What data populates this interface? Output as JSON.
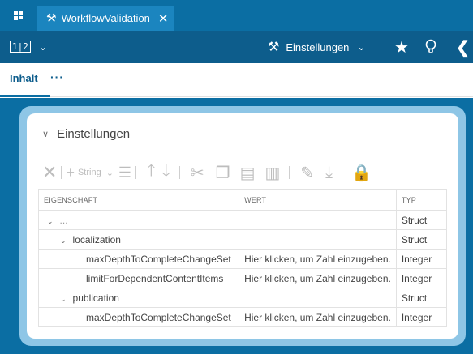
{
  "title_bar": {
    "tab_title": "WorkflowValidation",
    "tab_icon": "tools-icon",
    "close_glyph": "✕"
  },
  "toolbar": {
    "view_switch_label": "1|2",
    "settings_label": "Einstellungen",
    "icons": [
      "star-icon",
      "lightbulb-icon",
      "chevron-left-icon"
    ]
  },
  "subtabs": {
    "active": "Inhalt",
    "more": "···"
  },
  "section": {
    "title": "Einstellungen"
  },
  "edit_toolbar": {
    "string_label": "String"
  },
  "table": {
    "headers": [
      "EIGENSCHAFT",
      "WERT",
      "TYP"
    ],
    "rows": [
      {
        "name": "...",
        "value": "",
        "type": "Struct"
      },
      {
        "name": "localization",
        "value": "",
        "type": "Struct"
      },
      {
        "name": "maxDepthToCompleteChangeSet",
        "value": "Hier klicken, um Zahl einzugeben.",
        "type": "Integer"
      },
      {
        "name": "limitForDependentContentItems",
        "value": "Hier klicken, um Zahl einzugeben.",
        "type": "Integer"
      },
      {
        "name": "publication",
        "value": "",
        "type": "Struct"
      },
      {
        "name": "maxDepthToCompleteChangeSet",
        "value": "Hier klicken, um Zahl einzugeben.",
        "type": "Integer"
      }
    ]
  },
  "colors": {
    "titlebar": "#0b6ea3",
    "toolbar": "#0d5d8c",
    "tab_active": "#1b85bf",
    "frame": "#8ec6e6"
  }
}
